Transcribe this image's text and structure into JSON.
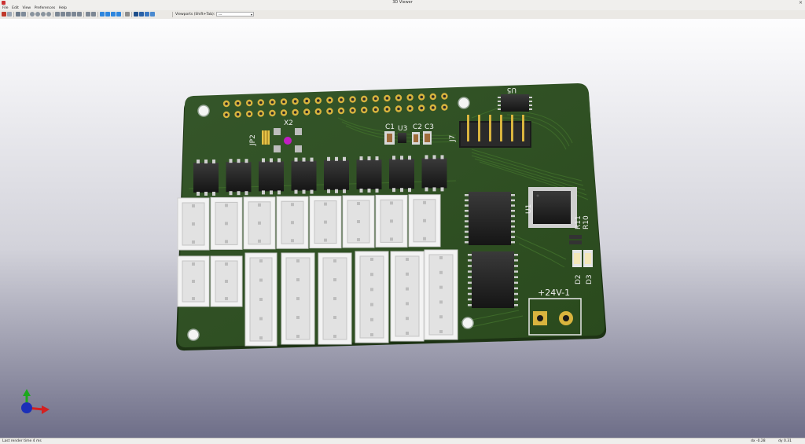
{
  "window": {
    "title": "3D Viewer",
    "close_glyph": "×"
  },
  "menu": {
    "items": [
      "File",
      "Edit",
      "View",
      "Preferences",
      "Help"
    ]
  },
  "toolbar": {
    "viewports_label": "Viewports (Shift+Tab):",
    "viewports_value": "---",
    "icons": [
      "close-icon",
      "copy-icon",
      "reload-icon",
      "redraw-icon",
      "zoom-in-icon",
      "zoom-out-icon",
      "zoom-fit-icon",
      "zoom-auto-icon",
      "rotate-x-icon",
      "rotate-x-ccw-icon",
      "rotate-y-icon",
      "rotate-y-ccw-icon",
      "rotate-z-icon",
      "rotate-z-ccw-icon",
      "flip-board-icon",
      "pan-left-icon",
      "pan-right-icon",
      "pan-up-icon",
      "pan-down-icon",
      "ortho-icon",
      "view-top-icon",
      "view-bottom-icon",
      "view-front-icon",
      "view-back-icon"
    ]
  },
  "board": {
    "labels": {
      "x2": "X2",
      "jp2": "JP2",
      "c1": "C1",
      "u3": "U3",
      "c2": "C2",
      "c3": "C3",
      "j7": "J7",
      "u5": "U5",
      "u1": "U1",
      "r11": "R11",
      "r10": "R10",
      "d2": "D2",
      "d3": "D3",
      "power": "+24V-1"
    },
    "colors": {
      "pcb": "#2c4a1e",
      "copper": "#d4b24a",
      "connector": "#f2f2f2",
      "ic": "#1e1e1e"
    }
  },
  "status": {
    "left": "Last render time 4 ms",
    "dx": "dx -0.28",
    "dy": "dy 0.31"
  }
}
